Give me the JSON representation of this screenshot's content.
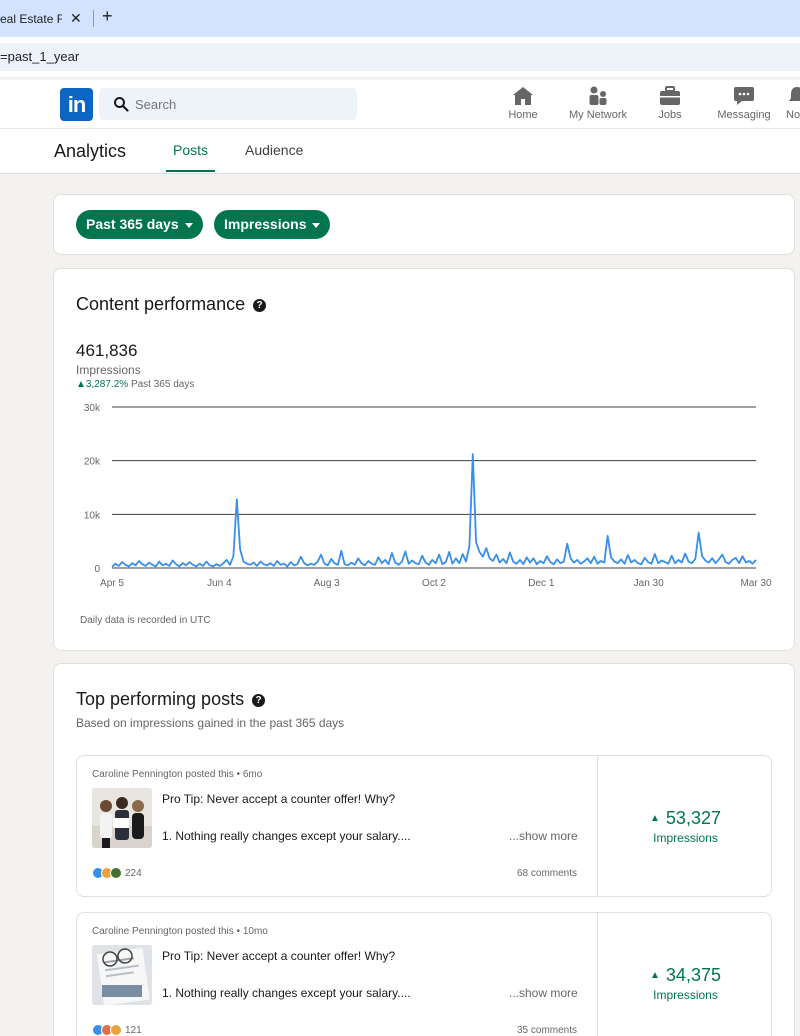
{
  "browser": {
    "tab_title": "eal Estate Fly",
    "new_tab_symbol": "+",
    "close_symbol": "✕",
    "url": "=past_1_year"
  },
  "nav": {
    "logo_text": "in",
    "search_placeholder": "Search",
    "items": [
      {
        "label": "Home",
        "icon": "home-icon"
      },
      {
        "label": "My Network",
        "icon": "network-icon"
      },
      {
        "label": "Jobs",
        "icon": "briefcase-icon"
      },
      {
        "label": "Messaging",
        "icon": "messaging-icon"
      },
      {
        "label": "No",
        "icon": "bell-icon"
      }
    ]
  },
  "analytics": {
    "title": "Analytics",
    "tabs": [
      {
        "label": "Posts",
        "active": true
      },
      {
        "label": "Audience",
        "active": false
      }
    ]
  },
  "filters": {
    "range_label": "Past 365 days",
    "metric_label": "Impressions"
  },
  "content_performance": {
    "title": "Content performance",
    "total": "461,836",
    "metric": "Impressions",
    "delta": "3,287.2%",
    "delta_period": "Past 365 days",
    "footnote": "Daily data is recorded in UTC"
  },
  "chart_data": {
    "type": "line",
    "title": "Content performance",
    "xlabel": "",
    "ylabel": "",
    "ylim": [
      0,
      30000
    ],
    "y_ticks": [
      "0",
      "10k",
      "20k",
      "30k"
    ],
    "x_ticks": [
      "Apr 5",
      "Jun 4",
      "Aug 3",
      "Oct 2",
      "Dec 1",
      "Jan 30",
      "Mar 30"
    ],
    "grid": true,
    "color": "#378fe9",
    "series": [
      {
        "values": [
          200,
          800,
          400,
          1100,
          600,
          300,
          900,
          500,
          1300,
          700,
          400,
          1000,
          600,
          300,
          1200,
          500,
          800,
          400,
          1400,
          700,
          300,
          900,
          500,
          1100,
          600,
          300,
          800,
          400,
          1200,
          500,
          300,
          700,
          400,
          900,
          1500,
          600,
          2200,
          12800,
          3500,
          1200,
          800,
          600,
          1000,
          400,
          1200,
          700,
          500,
          900,
          400,
          1300,
          600,
          800,
          300,
          1100,
          500,
          700,
          2100,
          900,
          500,
          800,
          600,
          1200,
          2500,
          800,
          500,
          1700,
          900,
          600,
          3200,
          700,
          500,
          1000,
          600,
          1800,
          900,
          500,
          1300,
          800,
          600,
          2000,
          900,
          1500,
          700,
          2800,
          1000,
          600,
          1200,
          3100,
          800,
          1400,
          900,
          700,
          2300,
          1000,
          600,
          1500,
          900,
          2500,
          700,
          1100,
          3000,
          800,
          1800,
          900,
          2600,
          1200,
          4100,
          21200,
          4800,
          3000,
          2100,
          3700,
          1800,
          1300,
          2500,
          1000,
          1700,
          900,
          2900,
          1200,
          800,
          1500,
          700,
          2000,
          1000,
          1800,
          700,
          1300,
          900,
          2200,
          1100,
          700,
          1600,
          900,
          1200,
          4500,
          1800,
          1000,
          1500,
          800,
          1200,
          1800,
          900,
          2100,
          800,
          1300,
          1000,
          6000,
          2000,
          1200,
          900,
          1600,
          800,
          2400,
          1000,
          1500,
          900,
          700,
          1900,
          1100,
          800,
          2600,
          900,
          1400,
          1100,
          800,
          2300,
          900,
          1500,
          1000,
          2700,
          1200,
          900,
          1700,
          6600,
          2200,
          1400,
          1000,
          1800,
          900,
          1600,
          2500,
          1100,
          800,
          1500,
          1900,
          900,
          2200,
          1000,
          1300,
          800,
          1500
        ],
        "peaks": [
          {
            "x": "Jun 4",
            "y": 12800
          },
          {
            "x": "Oct 4",
            "y": 21200
          }
        ]
      }
    ]
  },
  "top_posts": {
    "title": "Top performing posts",
    "subtitle": "Based on impressions gained in the past 365 days",
    "posts": [
      {
        "author": "Caroline Pennington",
        "posted_text": "posted this",
        "age": "6mo",
        "line1": "Pro Tip: Never accept a counter offer! Why?",
        "line2": "1. Nothing really changes except your salary....",
        "show_more": "...show more",
        "reactions": "224",
        "comments": "68 comments",
        "impressions": "53,327",
        "impressions_label": "Impressions"
      },
      {
        "author": "Caroline Pennington",
        "posted_text": "posted this",
        "age": "10mo",
        "line1": "Pro Tip: Never accept a counter offer! Why?",
        "line2": "1. Nothing really changes except your salary....",
        "show_more": "...show more",
        "reactions": "121",
        "comments": "35 comments",
        "impressions": "34,375",
        "impressions_label": "Impressions"
      }
    ]
  },
  "colors": {
    "linkedin_blue": "#0a66c2",
    "accent_green": "#01754f",
    "chart_line": "#378fe9"
  }
}
